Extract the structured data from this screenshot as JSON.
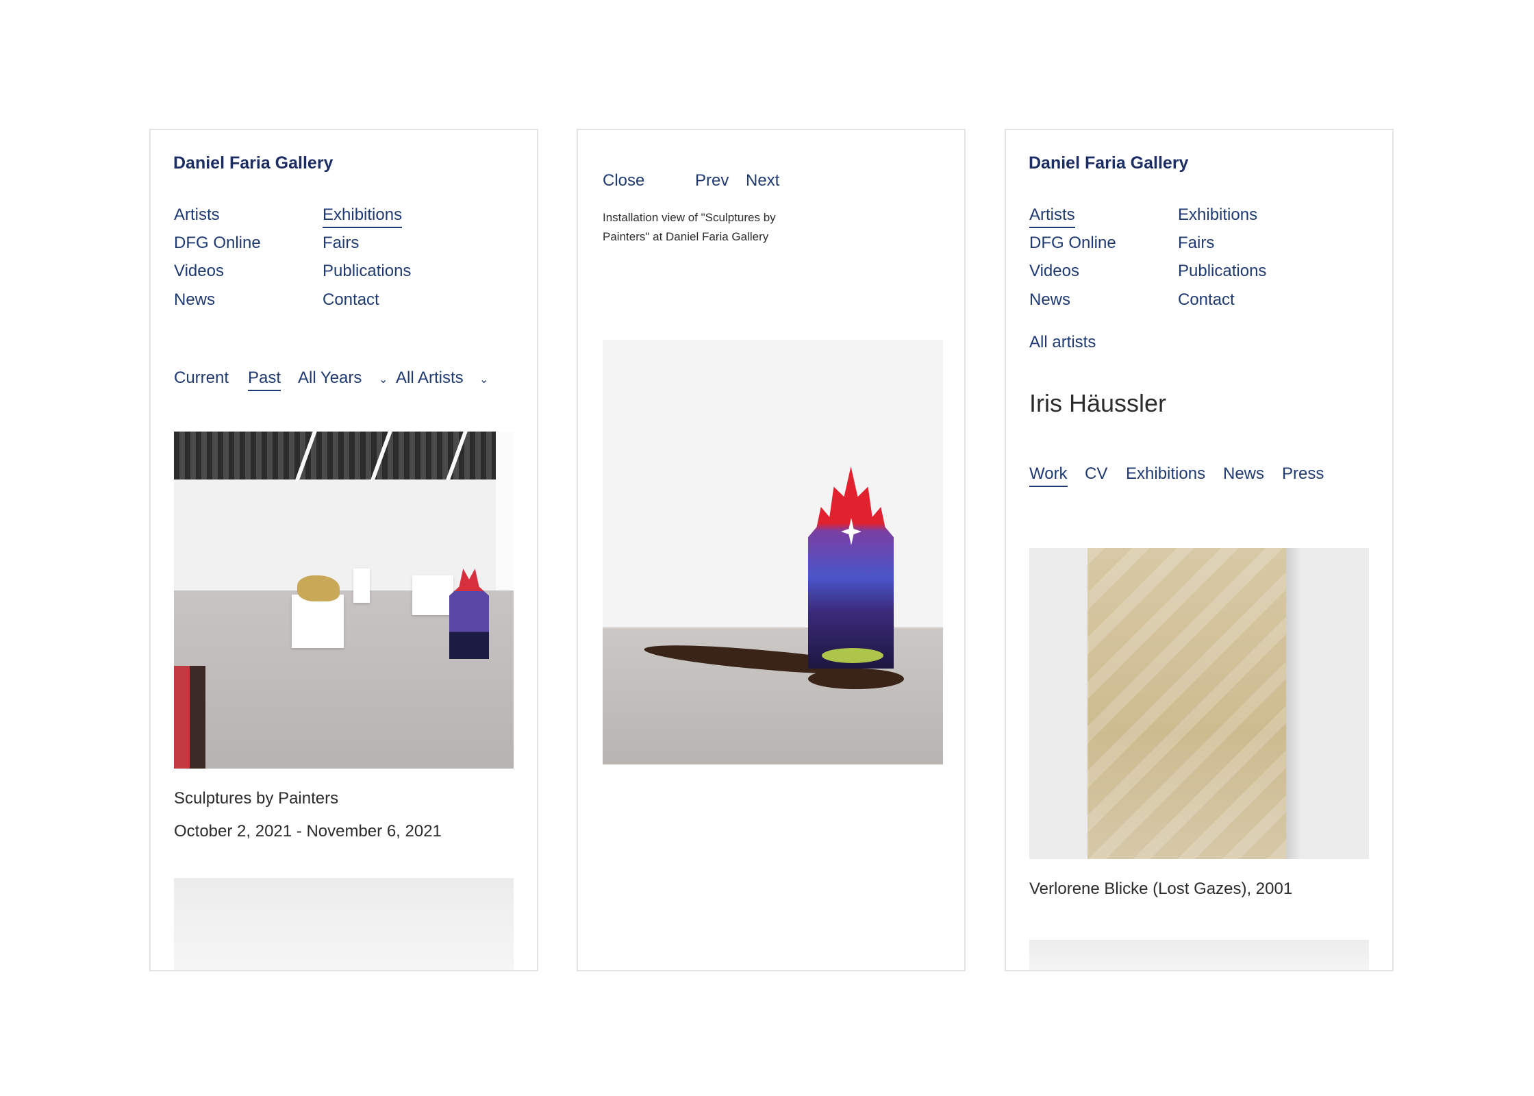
{
  "panel1": {
    "brand": "Daniel Faria Gallery",
    "nav": {
      "col1": [
        "Artists",
        "DFG Online",
        "Videos",
        "News"
      ],
      "col2": [
        "Exhibitions",
        "Fairs",
        "Publications",
        "Contact"
      ]
    },
    "filters": {
      "current": "Current",
      "past": "Past",
      "years": "All Years",
      "artists": "All Artists"
    },
    "exhibition": {
      "title": "Sculptures by Painters",
      "dates": "October 2, 2021 - November 6, 2021"
    }
  },
  "panel2": {
    "close": "Close",
    "prev": "Prev",
    "next": "Next",
    "caption_line1": "Installation view of \"Sculptures by",
    "caption_line2": "Painters\" at Daniel Faria Gallery"
  },
  "panel3": {
    "brand": "Daniel Faria Gallery",
    "nav": {
      "col1": [
        "Artists",
        "DFG Online",
        "Videos",
        "News"
      ],
      "col2": [
        "Exhibitions",
        "Fairs",
        "Publications",
        "Contact"
      ]
    },
    "all_artists": "All artists",
    "artist_name": "Iris Häussler",
    "tabs": [
      "Work",
      "CV",
      "Exhibitions",
      "News",
      "Press"
    ],
    "work_caption": "Verlorene Blicke (Lost Gazes), 2001"
  },
  "colors": {
    "link": "#1f3a72",
    "brand": "#1b2d63",
    "text": "#2c2c2c",
    "border": "#e4e4e4"
  },
  "icons": [
    "chevron-down-icon"
  ]
}
